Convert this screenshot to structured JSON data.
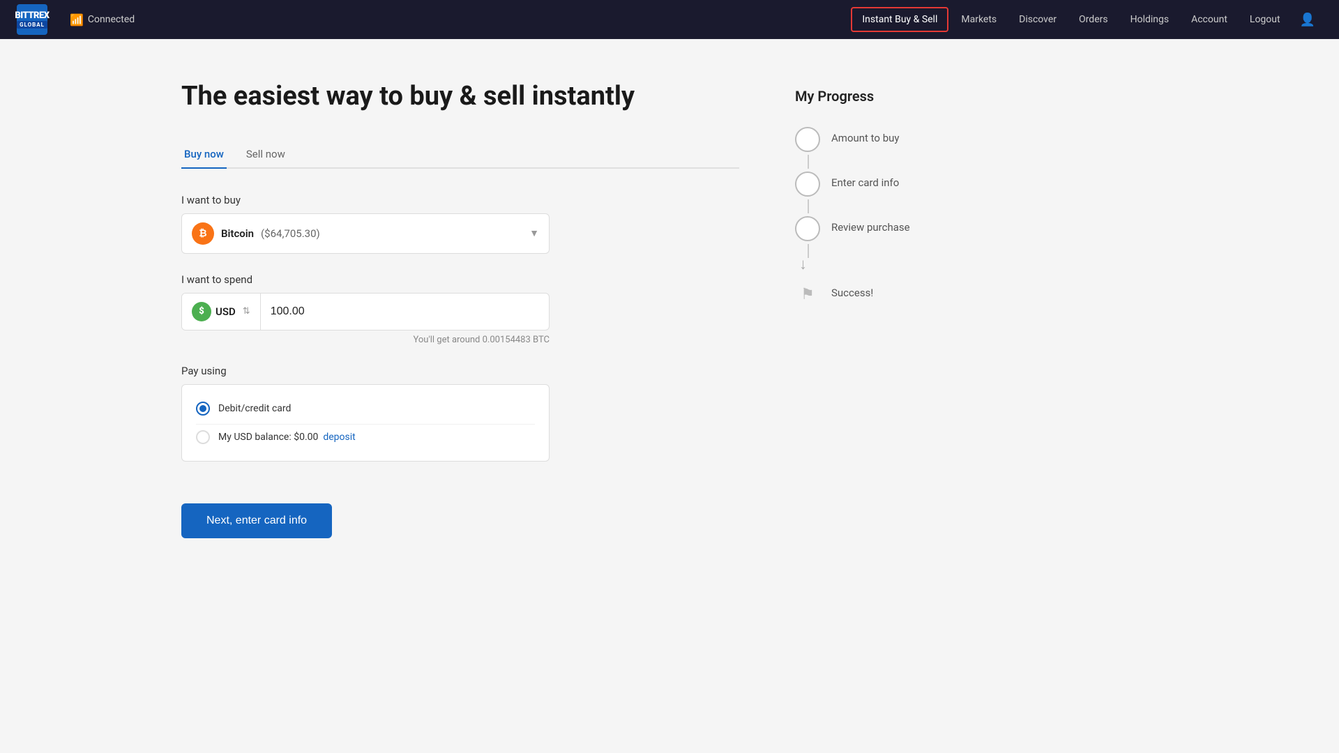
{
  "navbar": {
    "logo_top": "BITTREX",
    "logo_bottom": "GLOBAL",
    "connected_label": "Connected",
    "nav_links": [
      {
        "id": "instant-buy-sell",
        "label": "Instant Buy & Sell",
        "active": true
      },
      {
        "id": "markets",
        "label": "Markets",
        "active": false
      },
      {
        "id": "discover",
        "label": "Discover",
        "active": false
      },
      {
        "id": "orders",
        "label": "Orders",
        "active": false
      },
      {
        "id": "holdings",
        "label": "Holdings",
        "active": false
      },
      {
        "id": "account",
        "label": "Account",
        "active": false
      },
      {
        "id": "logout",
        "label": "Logout",
        "active": false
      }
    ]
  },
  "main": {
    "page_title": "The easiest way to buy & sell instantly",
    "tabs": [
      {
        "id": "buy-now",
        "label": "Buy now",
        "active": true
      },
      {
        "id": "sell-now",
        "label": "Sell now",
        "active": false
      }
    ],
    "want_to_buy_label": "I want to buy",
    "coin_name": "Bitcoin",
    "coin_price": "($64,705.30)",
    "coin_symbol": "₿",
    "want_to_spend_label": "I want to spend",
    "currency_code": "USD",
    "amount_value": "100.00",
    "btc_estimate": "You'll get around 0.00154483 BTC",
    "pay_using_label": "Pay using",
    "payment_options": [
      {
        "id": "debit-credit",
        "label": "Debit/credit card",
        "checked": true
      },
      {
        "id": "usd-balance",
        "label": "My USD balance: $0.00",
        "deposit_text": "deposit",
        "checked": false
      }
    ],
    "next_button_label": "Next, enter card info"
  },
  "progress": {
    "title": "My Progress",
    "steps": [
      {
        "id": "amount-to-buy",
        "label": "Amount to buy",
        "type": "circle"
      },
      {
        "id": "enter-card-info",
        "label": "Enter card info",
        "type": "circle"
      },
      {
        "id": "review-purchase",
        "label": "Review purchase",
        "type": "circle"
      },
      {
        "id": "success",
        "label": "Success!",
        "type": "flag"
      }
    ]
  }
}
